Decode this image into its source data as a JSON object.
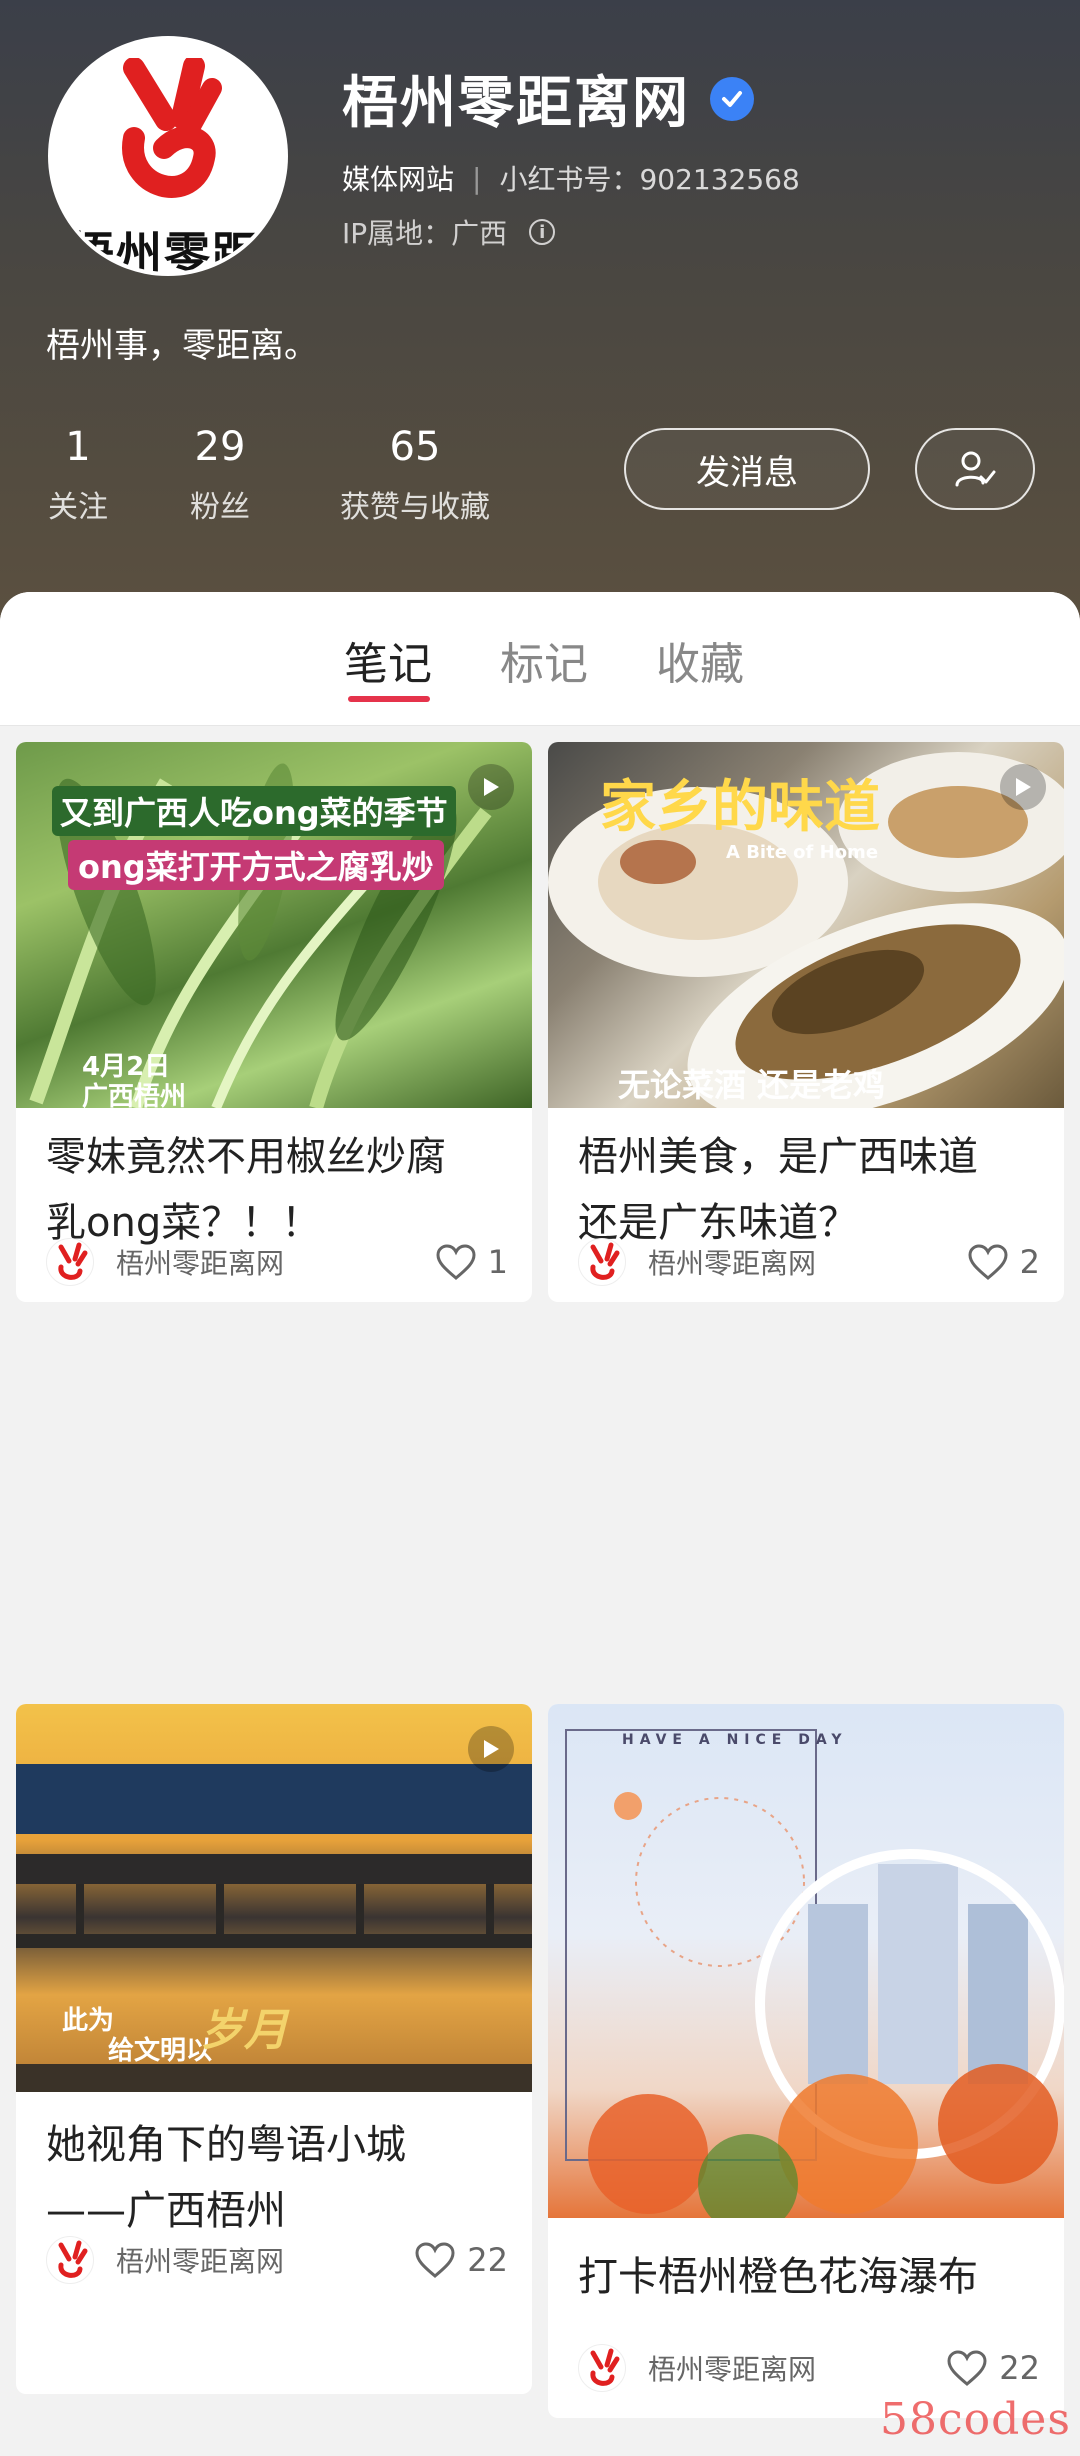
{
  "profile": {
    "avatar_text": "梧州零距",
    "name": "梧州零距离网",
    "type": "媒体网站",
    "xhs_id": "小红书号：902132568",
    "ip": "IP属地：广西",
    "bio": "梧州事，零距离。"
  },
  "stats": [
    {
      "num": "1",
      "label": "关注"
    },
    {
      "num": "29",
      "label": "粉丝"
    },
    {
      "num": "65",
      "label": "获赞与收藏"
    }
  ],
  "actions": {
    "message_label": "发消息"
  },
  "tabs": [
    {
      "label": "笔记",
      "active": true
    },
    {
      "label": "标记",
      "active": false
    },
    {
      "label": "收藏",
      "active": false
    }
  ],
  "notes": [
    {
      "title_line1": "零妹竟然不用椒丝炒腐",
      "title_line2": "乳ong菜？！！",
      "author": "梧州零距离网",
      "likes": "1",
      "overlay_line1": "又到广西人吃ong菜的季节",
      "overlay_line2": "ong菜打开方式之腐乳炒",
      "overlay_date": "4月2日",
      "overlay_place": "广西梧州"
    },
    {
      "title_line1": "梧州美食，是广西味道",
      "title_line2": "还是广东味道？",
      "author": "梧州零距离网",
      "likes": "2",
      "overlay_title": "家乡的味道",
      "overlay_sub": "A Bite of Home",
      "overlay_bottom": "无论菜酒 还是老鸡"
    },
    {
      "title_line1": "她视角下的粤语小城",
      "title_line2": "——广西梧州",
      "author": "梧州零距离网",
      "likes": "22",
      "overlay_line1": "此为",
      "overlay_line2": "给文明以",
      "overlay_line3": "岁月"
    },
    {
      "title_line1": "打卡梧州橙色花海瀑布",
      "author": "梧州零距离网",
      "likes": "22",
      "overlay_top": "HAVE A NICE DAY"
    }
  ],
  "watermark": "58codes",
  "colors": {
    "accent": "#e5334b",
    "verified": "#3b82f6"
  }
}
